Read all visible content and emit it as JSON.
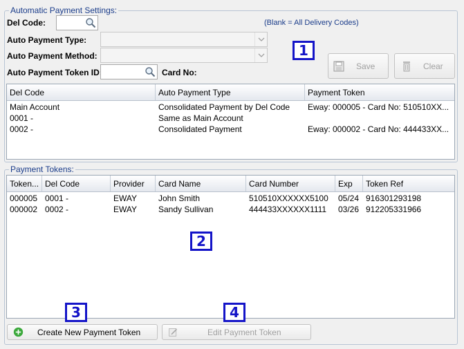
{
  "settings": {
    "title": "Automatic Payment Settings:",
    "del_code_label": "Del Code:",
    "hint": "(Blank = All Delivery Codes)",
    "auto_payment_type_label": "Auto Payment Type:",
    "auto_payment_method_label": "Auto Payment Method:",
    "auto_payment_token_label": "Auto Payment Token ID:",
    "card_no_label": "Card No:",
    "save_label": "Save",
    "clear_label": "Clear",
    "grid": {
      "columns": [
        "Del Code",
        "Auto Payment Type",
        "Payment Token"
      ],
      "rows": [
        [
          "Main Account",
          "Consolidated Payment by Del Code",
          "Eway: 000005 - Card No: 510510XX..."
        ],
        [
          "0001 -",
          "Same as Main Account",
          ""
        ],
        [
          "0002 -",
          "Consolidated Payment",
          "Eway: 000002 - Card No: 444433XX..."
        ]
      ]
    }
  },
  "tokens": {
    "title": "Payment Tokens:",
    "grid": {
      "columns": [
        "Token...",
        "Del Code",
        "Provider",
        "Card Name",
        "Card Number",
        "Exp",
        "Token Ref"
      ],
      "rows": [
        [
          "000005",
          "0001 -",
          "EWAY",
          "John Smith",
          "510510XXXXXX5100",
          "05/24",
          "916301293198"
        ],
        [
          "000002",
          "0002 -",
          "EWAY",
          "Sandy Sullivan",
          "444433XXXXXX1111",
          "03/26",
          "912205331966"
        ]
      ]
    },
    "create_label": "Create New Payment Token",
    "edit_label": "Edit Payment Token"
  },
  "markers": [
    "1",
    "2",
    "3",
    "4"
  ],
  "colors": {
    "group_title": "#1a3c8a",
    "marker": "#1414c8",
    "add_icon": "#3aa83a"
  }
}
